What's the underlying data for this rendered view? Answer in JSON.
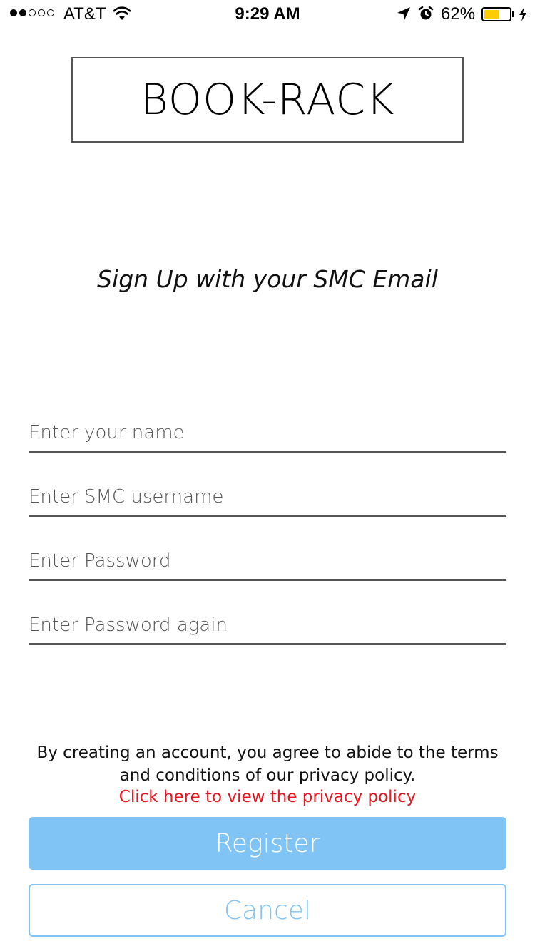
{
  "status_bar": {
    "signal_bars_filled": 2,
    "signal_bars_total": 5,
    "carrier": "AT&T",
    "time": "9:29 AM",
    "battery_percent_label": "62%",
    "battery_level": 0.62,
    "battery_color": "#ffcc00",
    "icons": [
      "wifi-icon",
      "location-arrow-icon",
      "alarm-icon",
      "battery-icon",
      "charging-bolt-icon"
    ]
  },
  "logo": {
    "text": "BOOK-RACK"
  },
  "subtitle": "Sign Up with your SMC Email",
  "form": {
    "name_placeholder": "Enter your name",
    "username_placeholder": "Enter SMC username",
    "password_placeholder": "Enter Password",
    "password_confirm_placeholder": "Enter Password again"
  },
  "terms": {
    "text": "By creating an account, you agree to abide to the terms and conditions of our privacy policy.",
    "link_text": "Click here to view the privacy policy",
    "link_color": "#e8141e"
  },
  "buttons": {
    "register_label": "Register",
    "cancel_label": "Cancel",
    "accent_color": "#80c4f6"
  }
}
